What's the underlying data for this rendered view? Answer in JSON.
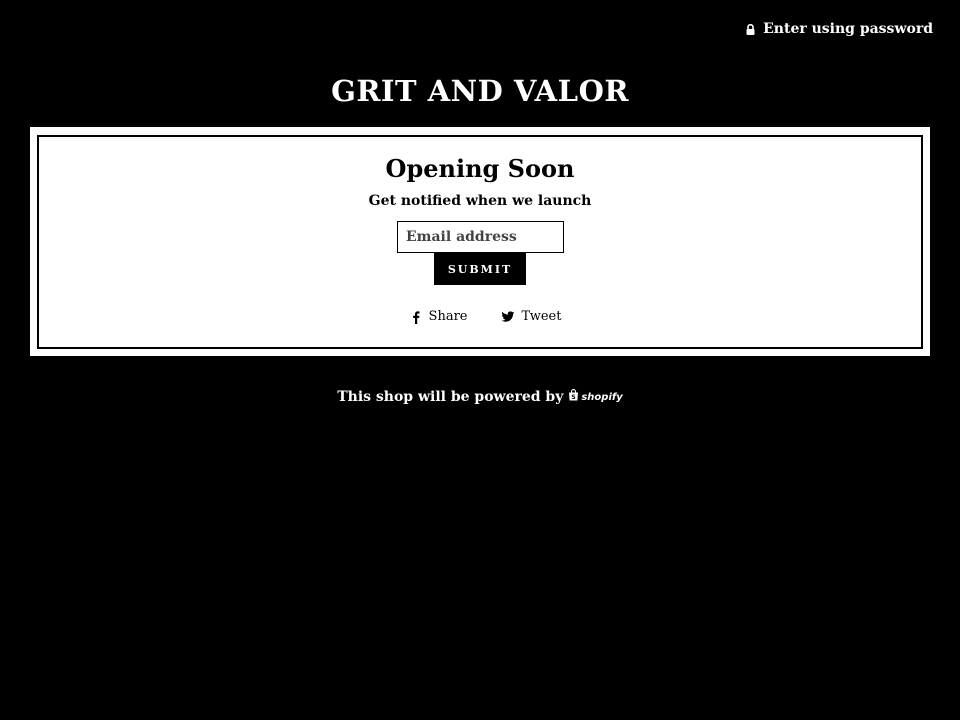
{
  "header": {
    "password_link": "Enter using password"
  },
  "store": {
    "title": "GRIT AND VALOR"
  },
  "card": {
    "heading": "Opening Soon",
    "subheading": "Get notified when we launch",
    "email_placeholder": "Email address",
    "submit_label": "SUBMIT",
    "share_label": "Share",
    "tweet_label": "Tweet"
  },
  "footer": {
    "powered_by": "This shop will be powered by",
    "shopify_wordmark": "shopify"
  },
  "icons": {
    "lock": "lock-icon",
    "facebook": "facebook-icon",
    "twitter": "twitter-icon",
    "shopify_bag": "shopify-bag-icon"
  },
  "colors": {
    "background": "#000000",
    "card": "#ffffff",
    "text_light": "#ffffff",
    "text_dark": "#000000"
  }
}
